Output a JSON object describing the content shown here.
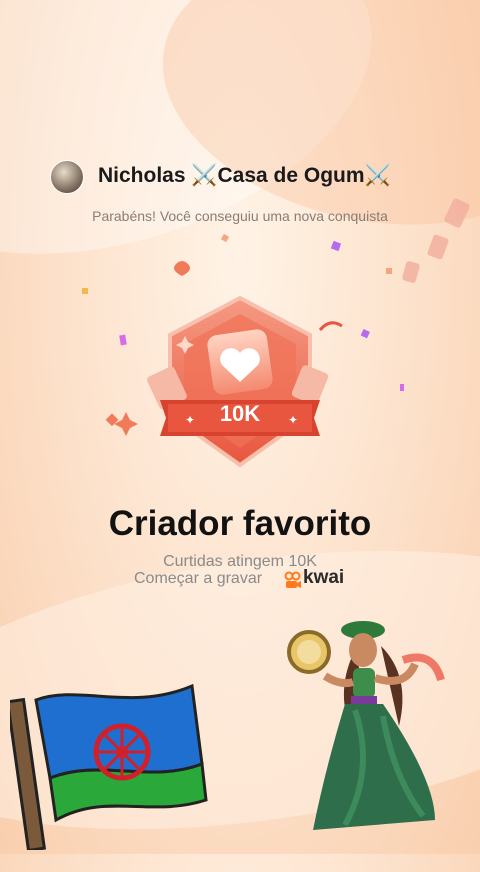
{
  "header": {
    "username": "Nicholas ⚔️Casa de Ogum⚔️",
    "subtitle": "Parabéns! Você conseguiu uma nova conquista"
  },
  "badge": {
    "label": "10K",
    "icon": "heart-icon",
    "color_primary": "#e8563f",
    "color_secondary": "#f6a58e"
  },
  "achievement": {
    "title": "Criador favorito",
    "line1": "Curtidas atingem 10K",
    "line2": "Começar a gravar",
    "brand": "kwai",
    "brand_color": "#ff7a1a"
  },
  "stickers": {
    "flag": "romani-flag-icon",
    "dancer": "dancer-sticker"
  }
}
